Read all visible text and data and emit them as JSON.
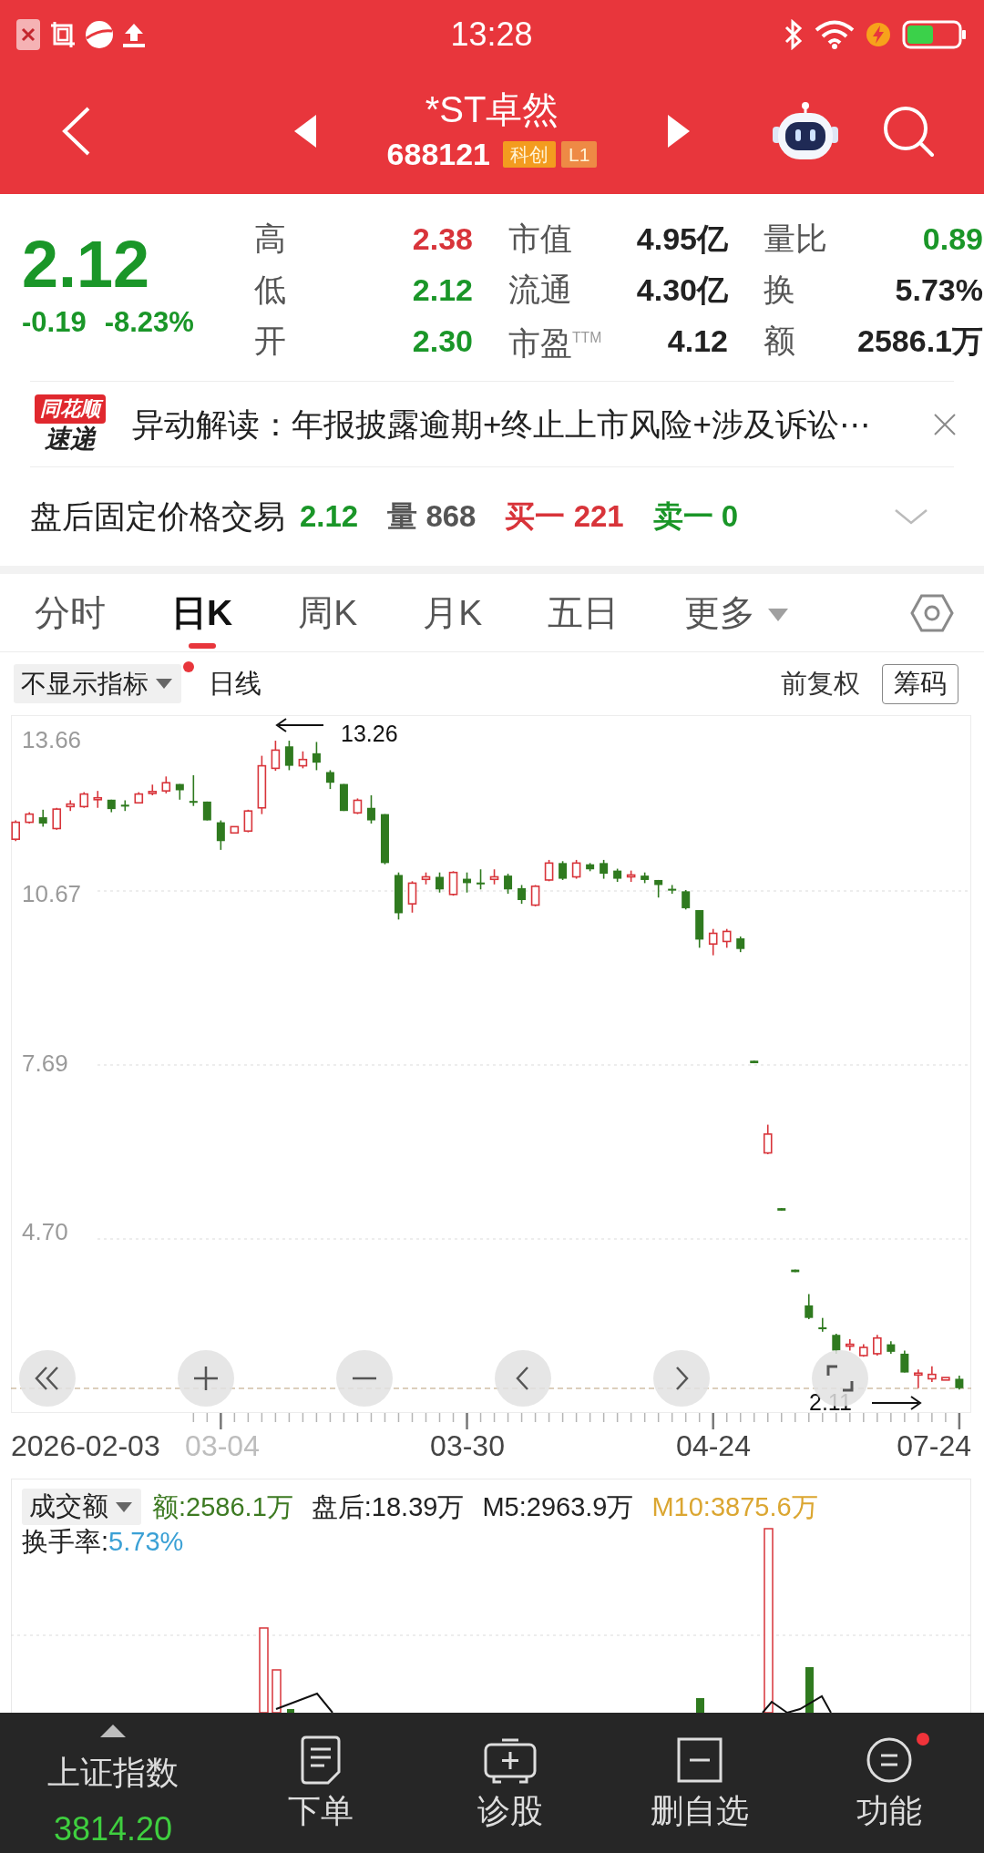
{
  "status_bar": {
    "time": "13:28"
  },
  "header": {
    "title": "*ST卓然",
    "code": "688121",
    "tags": [
      {
        "text": "科创",
        "color": "#f39c1f"
      },
      {
        "text": "L1",
        "color": "#ee8a45"
      }
    ]
  },
  "quote": {
    "price": "2.12",
    "change": "-0.19",
    "change_pct": "-8.23%",
    "falling": true,
    "stats": [
      {
        "label": "高",
        "value": "2.38",
        "color": "#d8343a"
      },
      {
        "label": "市值",
        "value": "4.95亿",
        "color": "#222222"
      },
      {
        "label": "量比",
        "value": "0.89",
        "color": "#1a9628"
      },
      {
        "label": "低",
        "value": "2.12",
        "color": "#1a9628"
      },
      {
        "label": "流通",
        "value": "4.30亿",
        "color": "#222222"
      },
      {
        "label": "换",
        "value": "5.73%",
        "color": "#222222"
      },
      {
        "label": "开",
        "value": "2.30",
        "color": "#1a9628"
      },
      {
        "label": "市盈$^{TTM}$",
        "value": "4.12",
        "color": "#222222"
      },
      {
        "label": "额",
        "value": "2586.1万",
        "color": "#222222"
      }
    ]
  },
  "news": {
    "logo_top": "同花顺",
    "logo_bottom": "速递",
    "text": "异动解读：年报披露逾期+终止上市风险+涉及诉讼⋯"
  },
  "after_hours": {
    "title": "盘后固定价格交易",
    "expanded": false,
    "items": [
      {
        "text": "2.12",
        "color": "#1a9628"
      },
      {
        "text": "量 868",
        "color": "#555555"
      },
      {
        "text": "买一 221",
        "color": "#d8343a"
      },
      {
        "text": "卖一 0",
        "color": "#1a9628"
      }
    ]
  },
  "tabs": [
    {
      "label": "分时",
      "selected": false,
      "kind": "tab"
    },
    {
      "label": "日K",
      "selected": true,
      "kind": "tab"
    },
    {
      "label": "周K",
      "selected": false,
      "kind": "tab"
    },
    {
      "label": "月K",
      "selected": false,
      "kind": "tab"
    },
    {
      "label": "五日",
      "selected": false,
      "kind": "tab"
    },
    {
      "label": "更多",
      "selected": false,
      "kind": "menu"
    }
  ],
  "chart_toolbar": {
    "indicator": "不显示指标",
    "indicator_badge": true,
    "period": "日线",
    "adjust": "前复权",
    "chips_button": "筹码"
  },
  "kline": {
    "price_labels": [
      "13.66",
      "10.67",
      "7.69",
      "4.70"
    ],
    "high_marker": "13.26",
    "low_marker": "2.11",
    "dates": [
      {
        "text": "2026-02-03",
        "dimmed": false
      },
      {
        "text": "03-04",
        "dimmed": true
      },
      {
        "text": "03-30",
        "dimmed": false
      },
      {
        "text": "04-24",
        "dimmed": false
      },
      {
        "text": "07-24",
        "dimmed": false
      }
    ]
  },
  "volume_panel": {
    "selector": "成交额",
    "stats": [
      {
        "text": "额:2586.1万",
        "color": "#3d7a22"
      },
      {
        "text": "盘后:18.39万",
        "color": "#222222"
      },
      {
        "text": "M5:2963.9万",
        "color": "#222222"
      },
      {
        "text": "M10:3875.6万",
        "color": "#dba631"
      }
    ],
    "turnover_label": "换手率:",
    "turnover_value": "5.73%"
  },
  "bottom_nav": [
    {
      "kind": "index",
      "label": "上证指数",
      "value": "3814.20",
      "falling": true,
      "notification": false
    },
    {
      "kind": "action",
      "label": "下单",
      "notification": false
    },
    {
      "kind": "action",
      "label": "诊股",
      "notification": false
    },
    {
      "kind": "action",
      "label": "删自选",
      "notification": false
    },
    {
      "kind": "action",
      "label": "功能",
      "notification": true
    }
  ]
}
